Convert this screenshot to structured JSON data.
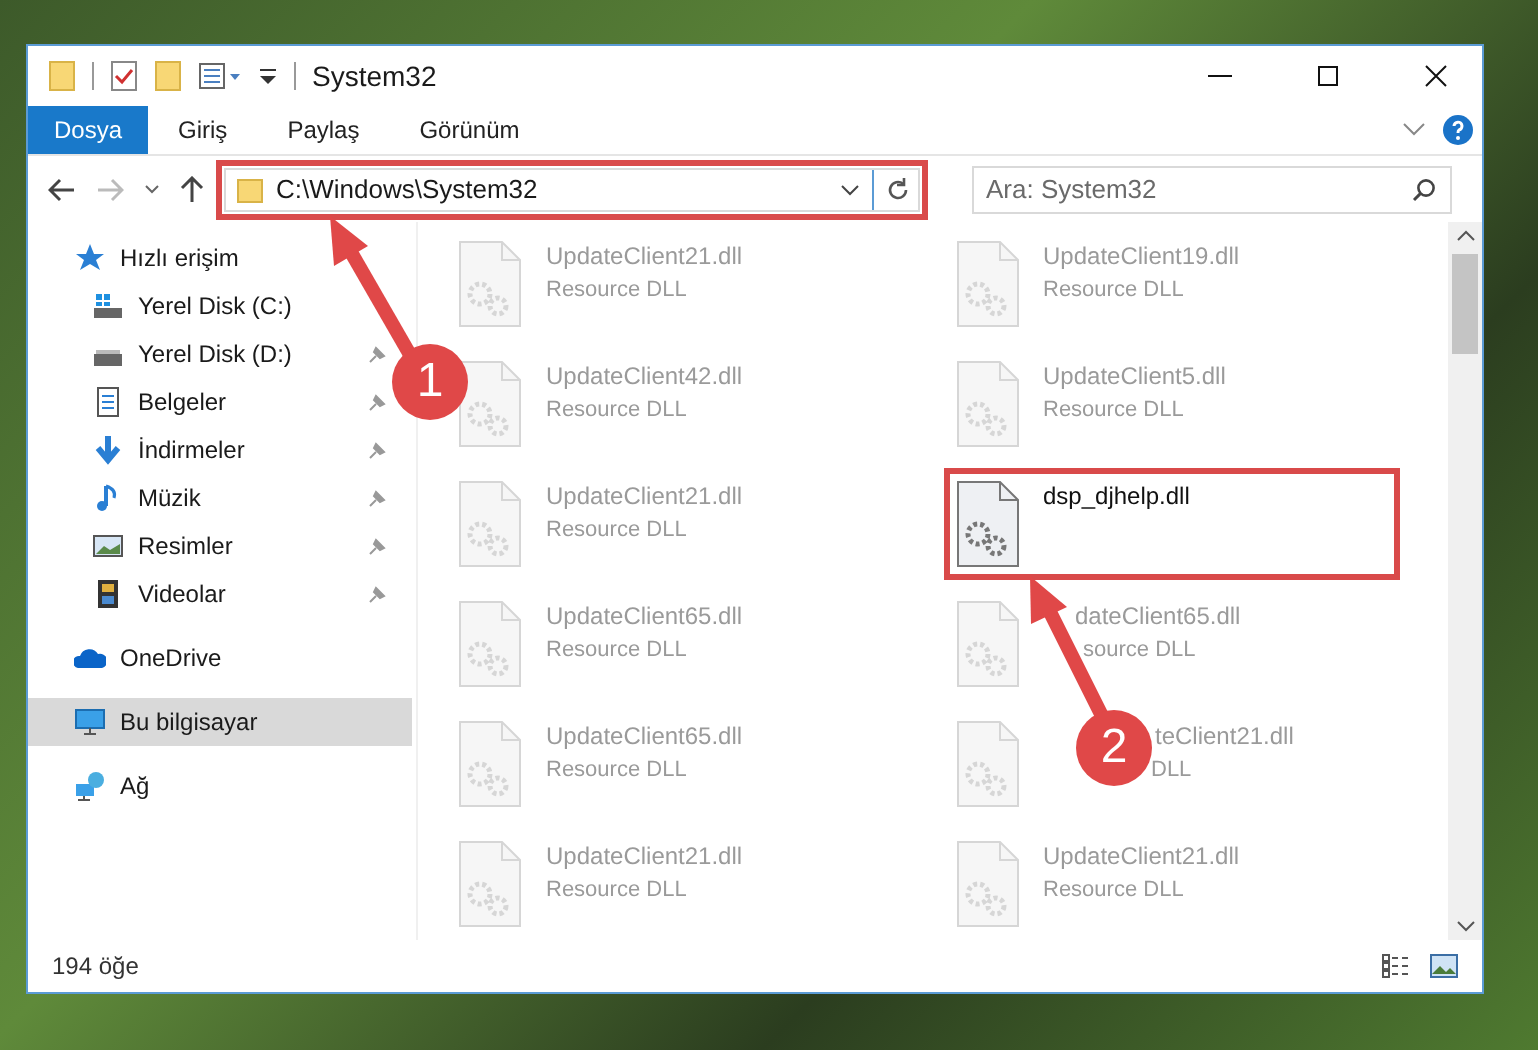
{
  "window": {
    "title": "System32"
  },
  "ribbon_tabs": [
    {
      "label": "Dosya",
      "kind": "file"
    },
    {
      "label": "Giriş",
      "kind": "tab"
    },
    {
      "label": "Paylaş",
      "kind": "tab"
    },
    {
      "label": "Görünüm",
      "kind": "tab"
    }
  ],
  "address_bar": {
    "path": "C:\\Windows\\System32"
  },
  "search": {
    "placeholder": "Ara: System32"
  },
  "sidebar": {
    "items": [
      {
        "label": "Hızlı erişim",
        "kind": "star",
        "selected": false,
        "children": [
          {
            "label": "Yerel Disk (C:)",
            "kind": "drive-windows",
            "pinned": false,
            "selected": false
          },
          {
            "label": "Yerel Disk (D:)",
            "kind": "drive",
            "pinned": true,
            "selected": false
          },
          {
            "label": "Belgeler",
            "kind": "documents",
            "pinned": true,
            "selected": false
          },
          {
            "label": "İndirmeler",
            "kind": "downloads",
            "pinned": true,
            "selected": false
          },
          {
            "label": "Müzik",
            "kind": "music",
            "pinned": true,
            "selected": false
          },
          {
            "label": "Resimler",
            "kind": "pictures",
            "pinned": true,
            "selected": false
          },
          {
            "label": "Videolar",
            "kind": "videos",
            "pinned": true,
            "selected": false
          }
        ]
      },
      {
        "label": "OneDrive",
        "kind": "cloud",
        "selected": false
      },
      {
        "label": "Bu bilgisayar",
        "kind": "computer",
        "selected": true
      },
      {
        "label": "Ağ",
        "kind": "network",
        "selected": false
      }
    ]
  },
  "files": [
    {
      "name": "UpdateClient21.dll",
      "type": "Resource DLL",
      "emphasized": false
    },
    {
      "name": "UpdateClient19.dll",
      "type": "Resource DLL",
      "emphasized": false
    },
    {
      "name": "UpdateClient42.dll",
      "type": "Resource DLL",
      "emphasized": false
    },
    {
      "name": "UpdateClient5.dll",
      "type": "Resource DLL",
      "emphasized": false
    },
    {
      "name": "UpdateClient21.dll",
      "type": "Resource DLL",
      "emphasized": false
    },
    {
      "name": "dsp_djhelp.dll",
      "emphasized": true
    },
    {
      "name": "UpdateClient65.dll",
      "type": "Resource DLL",
      "emphasized": false
    },
    {
      "name": "dateClient65.dll",
      "type": "source DLL",
      "emphasized": false
    },
    {
      "name": "UpdateClient65.dll",
      "type": "Resource DLL",
      "emphasized": false
    },
    {
      "name": "teClient21.dll",
      "type": "DLL",
      "emphasized": false
    },
    {
      "name": "UpdateClient21.dll",
      "type": "Resource DLL",
      "emphasized": false
    },
    {
      "name": "UpdateClient21.dll",
      "type": "Resource DLL",
      "emphasized": false
    }
  ],
  "status_bar": {
    "count": "194 öğe"
  },
  "callouts": [
    {
      "label": "1"
    },
    {
      "label": "2"
    }
  ]
}
